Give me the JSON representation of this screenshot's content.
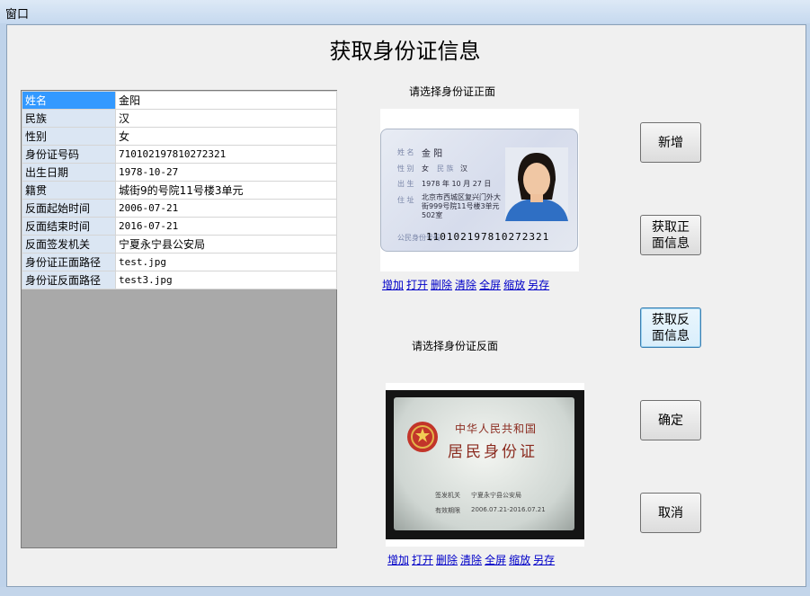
{
  "window": {
    "title": "窗口"
  },
  "heading": "获取身份证信息",
  "table": {
    "rows": [
      {
        "key": "姓名",
        "value": "金阳"
      },
      {
        "key": "民族",
        "value": "汉"
      },
      {
        "key": "性别",
        "value": "女"
      },
      {
        "key": "身份证号码",
        "value": "710102197810272321"
      },
      {
        "key": "出生日期",
        "value": "1978-10-27"
      },
      {
        "key": "籍贯",
        "value": "城街9的号院11号楼3单元"
      },
      {
        "key": "反面起始时间",
        "value": "2006-07-21"
      },
      {
        "key": "反面结束时间",
        "value": "2016-07-21"
      },
      {
        "key": "反面签发机关",
        "value": "宁夏永宁县公安局"
      },
      {
        "key": "身份证正面路径",
        "value": "test.jpg"
      },
      {
        "key": "身份证反面路径",
        "value": "test3.jpg"
      }
    ]
  },
  "front": {
    "label": "请选择身份证正面",
    "card": {
      "name_label": "姓 名",
      "name": "金 阳",
      "sex_label": "性 别",
      "sex": "女",
      "nation_label": "民 族",
      "nation": "汉",
      "birth_label": "出 生",
      "birth": "1978  年 10 月 27 日",
      "addr_label": "住 址",
      "addr1": "北京市西城区复兴门外大",
      "addr2": "街999号院11号楼3单元",
      "addr3": "502室",
      "num_label": "公民身份号码",
      "num": "110102197810272321"
    },
    "links": [
      "增加",
      "打开",
      "删除",
      "清除",
      "全屏",
      "缩放",
      "另存"
    ]
  },
  "back": {
    "label": "请选择身份证反面",
    "card": {
      "country": "中华人民共和国",
      "title": "居民身份证",
      "authority_label": "签发机关",
      "authority": "宁夏永宁县公安局",
      "valid_label": "有效期限",
      "valid": "2006.07.21-2016.07.21"
    },
    "links": [
      "增加",
      "打开",
      "删除",
      "清除",
      "全屏",
      "缩放",
      "另存"
    ]
  },
  "buttons": {
    "add": "新增",
    "get_front": "获取正面信息",
    "get_back": "获取反面信息",
    "ok": "确定",
    "cancel": "取消"
  },
  "colors": {
    "selected_row": "#3399ff",
    "key_cell": "#dbe6f3",
    "link": "#0000c8",
    "grid_bg": "#a9a9a9"
  }
}
